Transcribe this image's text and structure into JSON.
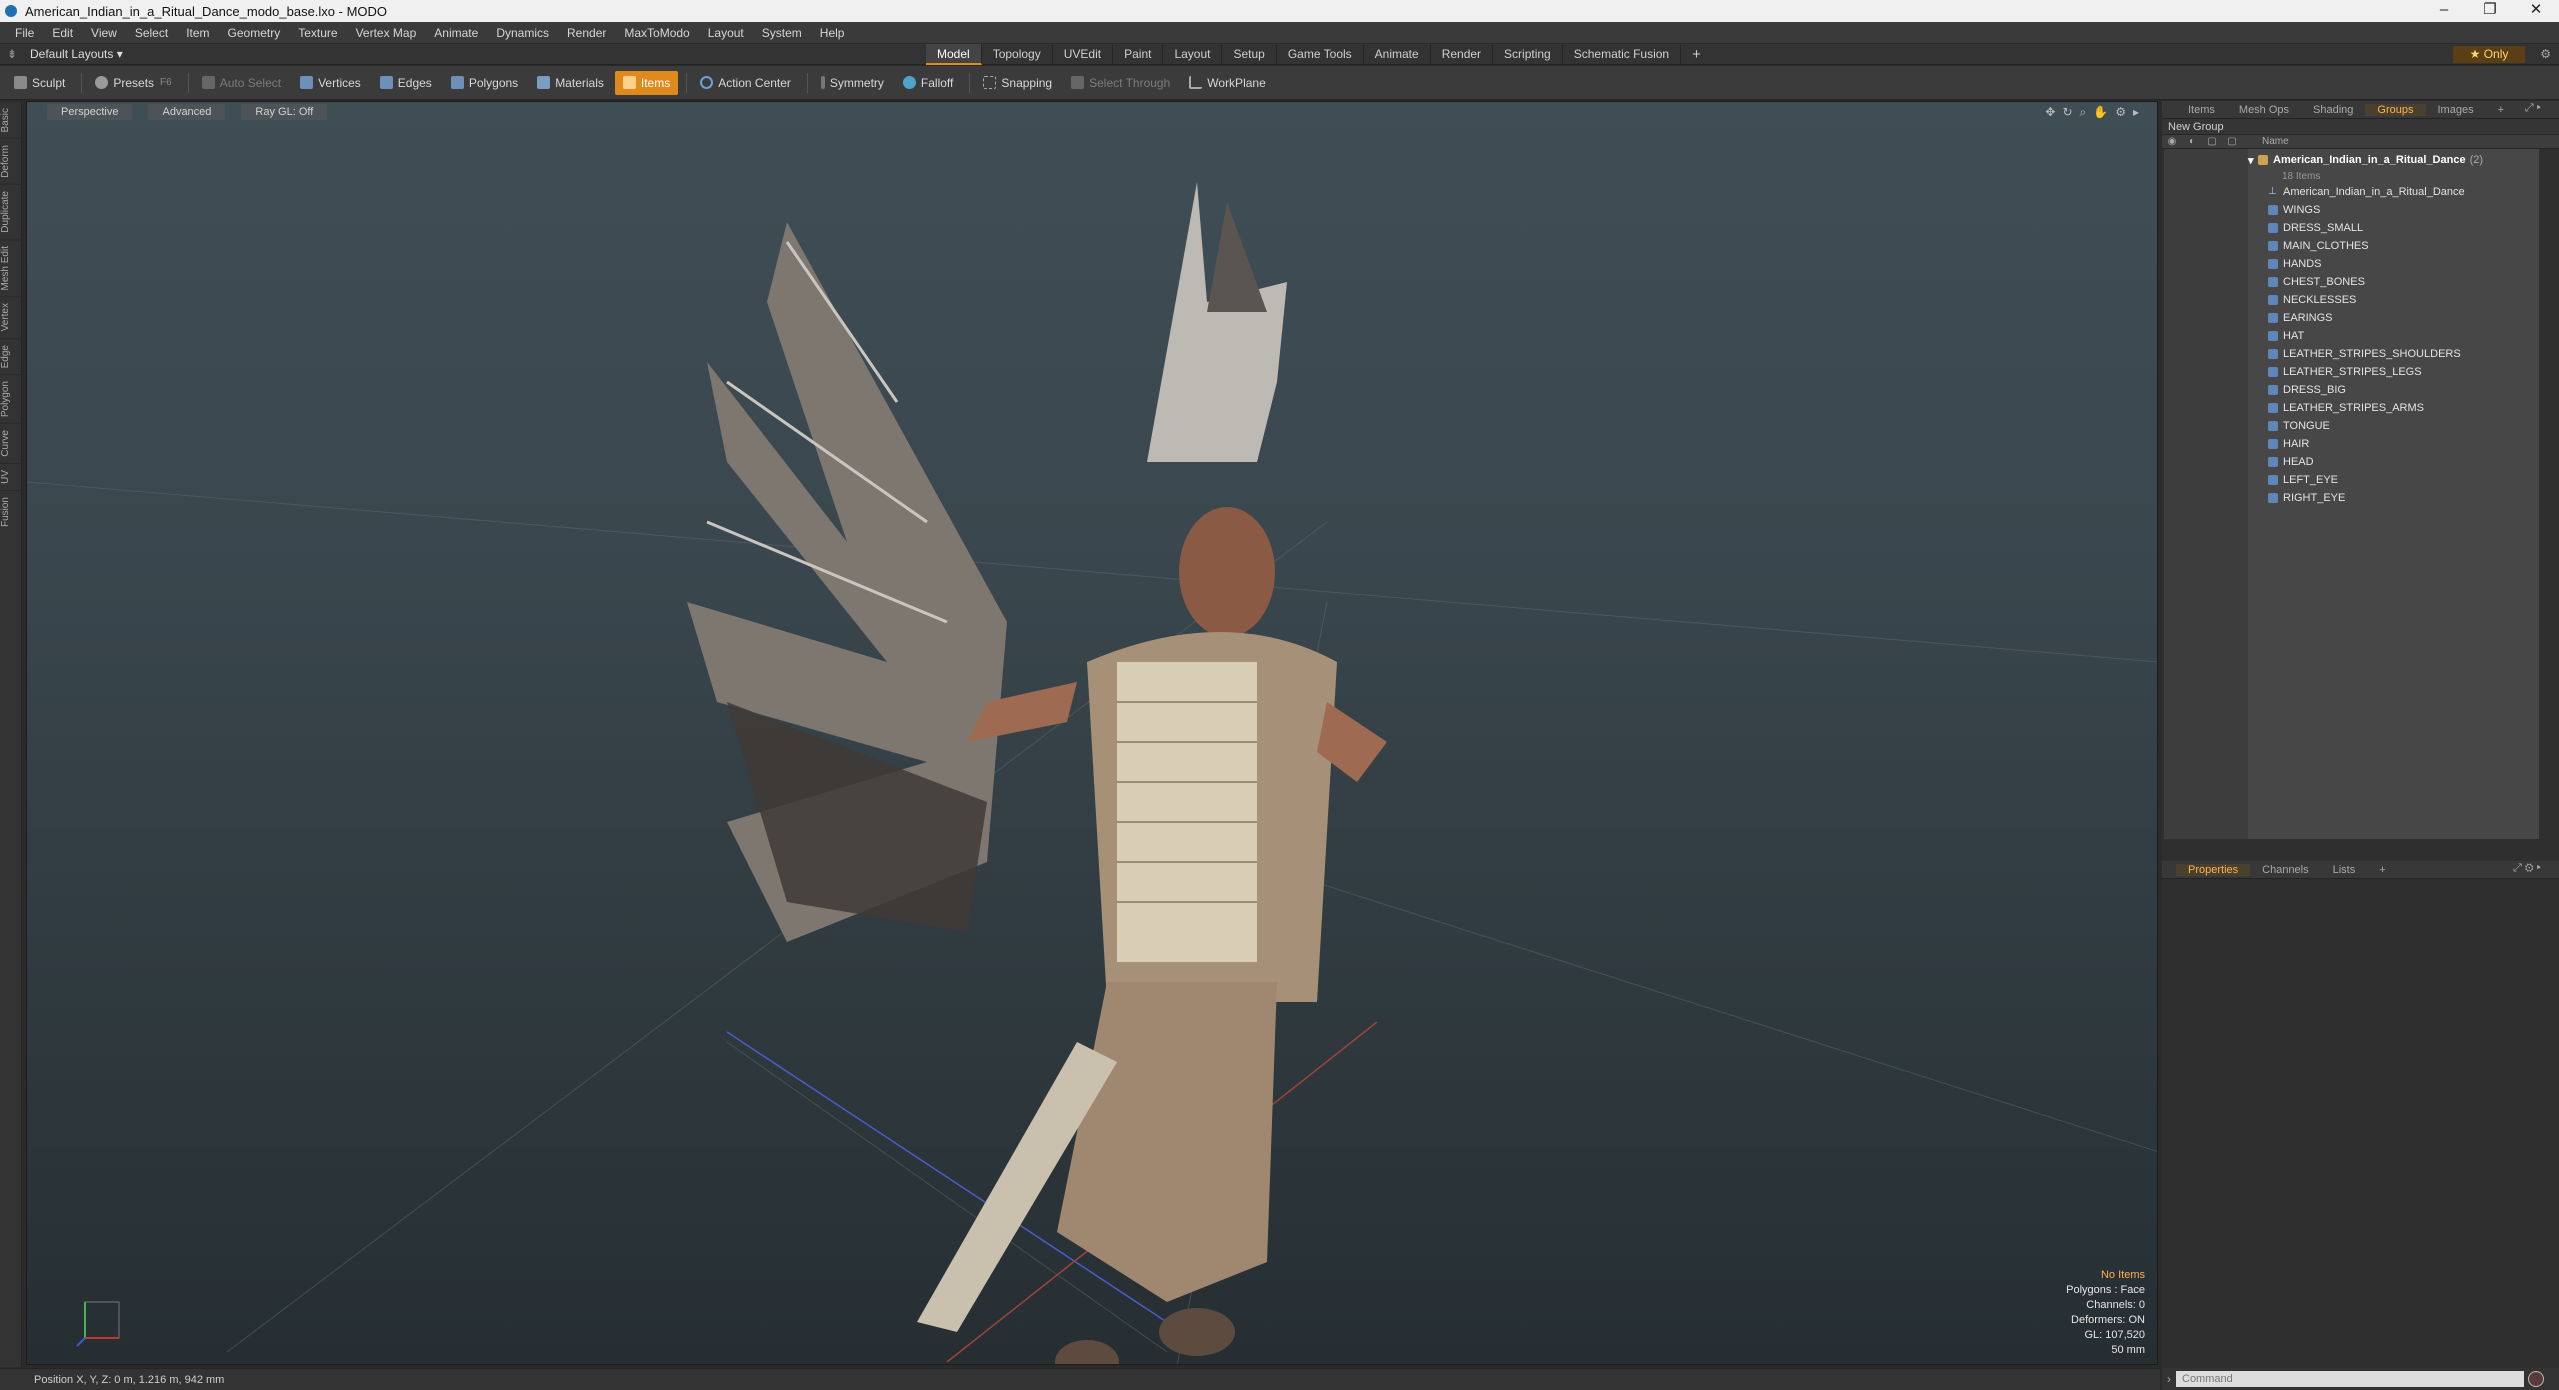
{
  "window": {
    "title": "American_Indian_in_a_Ritual_Dance_modo_base.lxo - MODO",
    "minimize": "–",
    "maximize": "❐",
    "close": "✕"
  },
  "menu": [
    "File",
    "Edit",
    "View",
    "Select",
    "Item",
    "Geometry",
    "Texture",
    "Vertex Map",
    "Animate",
    "Dynamics",
    "Render",
    "MaxToModo",
    "Layout",
    "System",
    "Help"
  ],
  "layoutbar": {
    "layout_dropdown": "Default Layouts ▾",
    "modes": [
      "Model",
      "Topology",
      "UVEdit",
      "Paint",
      "Layout",
      "Setup",
      "Game Tools",
      "Animate",
      "Render",
      "Scripting",
      "Schematic Fusion"
    ],
    "active_mode": "Model",
    "add": "+",
    "only_label": "★  Only"
  },
  "toolbar": {
    "sculpt": "Sculpt",
    "presets": "Presets",
    "presets_key": "F6",
    "auto_select": "Auto Select",
    "vertices": "Vertices",
    "edges": "Edges",
    "polygons": "Polygons",
    "materials": "Materials",
    "items": "Items",
    "action_center": "Action Center",
    "symmetry": "Symmetry",
    "falloff": "Falloff",
    "snapping": "Snapping",
    "select_through": "Select Through",
    "workplane": "WorkPlane"
  },
  "lefttabs": [
    "Basic",
    "Deform",
    "Duplicate",
    "Mesh Edit",
    "Vertex",
    "Edge",
    "Polygon",
    "Curve",
    "UV",
    "Fusion"
  ],
  "viewport": {
    "view": "Perspective",
    "shading": "Advanced",
    "raygl": "Ray GL: Off",
    "info_items": "No Items",
    "info_polygons": "Polygons : Face",
    "info_channels": "Channels: 0",
    "info_deformers": "Deformers: ON",
    "info_gl": "GL: 107,520",
    "info_mm": "50 mm"
  },
  "status": {
    "position": "Position X, Y, Z:   0 m, 1.216 m, 942 mm"
  },
  "panel_top": {
    "tabs": [
      "Items",
      "Mesh Ops",
      "Shading",
      "Groups",
      "Images"
    ],
    "active_tab": "Groups",
    "new_group": "New Group",
    "col_name": "Name",
    "group_name": "American_Indian_in_a_Ritual_Dance",
    "group_count": "(2)",
    "group_sub": "18 Items",
    "locator": "American_Indian_in_a_Ritual_Dance",
    "meshes": [
      "WINGS",
      "DRESS_SMALL",
      "MAIN_CLOTHES",
      "HANDS",
      "CHEST_BONES",
      "NECKLESSES",
      "EARINGS",
      "HAT",
      "LEATHER_STRIPES_SHOULDERS",
      "LEATHER_STRIPES_LEGS",
      "DRESS_BIG",
      "LEATHER_STRIPES_ARMS",
      "TONGUE",
      "HAIR",
      "HEAD",
      "LEFT_EYE",
      "RIGHT_EYE"
    ]
  },
  "panel_bottom": {
    "tabs": [
      "Properties",
      "Channels",
      "Lists"
    ],
    "active_tab": "Properties"
  },
  "command": {
    "placeholder": "Command"
  },
  "colors": {
    "accent": "#e08a1e",
    "active_text": "#ffb14d"
  }
}
